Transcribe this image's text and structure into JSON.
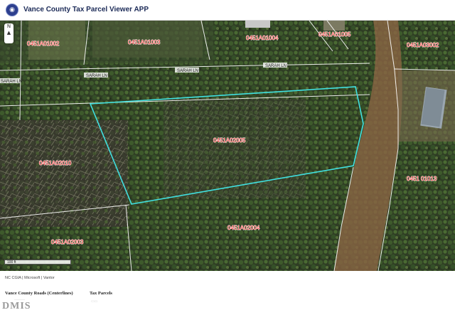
{
  "app": {
    "title": "Vance County Tax Parcel Viewer APP",
    "seal_icon": "county-seal-icon"
  },
  "map": {
    "parcels": [
      {
        "id": "0451A01002"
      },
      {
        "id": "0451A01003"
      },
      {
        "id": "0451A01004"
      },
      {
        "id": "0451A01005"
      },
      {
        "id": "0451A03002"
      },
      {
        "id": "0451A02005",
        "selected": true
      },
      {
        "id": "0451A02010"
      },
      {
        "id": "0451 01013"
      },
      {
        "id": "0451A02004"
      },
      {
        "id": "0451A02003"
      }
    ],
    "roads": [
      "SARAH LN",
      "SARAH LN",
      "SARAH LN",
      "SARAH LN"
    ],
    "scale_label": "100 ft",
    "compass_label": "N",
    "selection_color": "#40e0e0",
    "label_color": "#ff3b3b"
  },
  "attribution": "NC CGIA | Microsoft | Vantor",
  "legend": {
    "items": [
      {
        "label": "Vance County Roads (Centerlines)"
      },
      {
        "label": "Tax Parcels"
      }
    ]
  },
  "logo": {
    "text": "DMIS"
  }
}
